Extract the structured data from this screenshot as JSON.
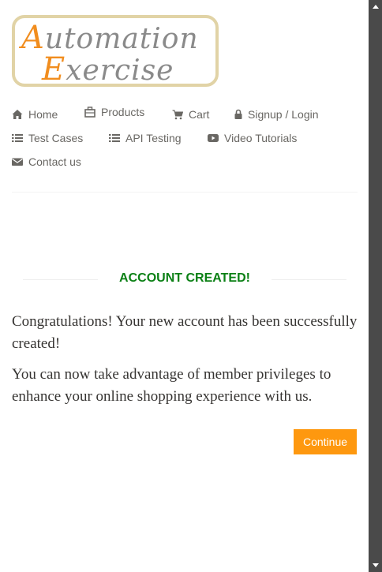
{
  "logo": {
    "line1_cap": "A",
    "line1_rest": "utomation",
    "line2_cap": "E",
    "line2_rest": "xercise"
  },
  "nav": {
    "items": [
      {
        "label": "Home",
        "icon": "home-icon"
      },
      {
        "label": "Products",
        "icon": "products-icon"
      },
      {
        "label": "Cart",
        "icon": "cart-icon"
      },
      {
        "label": "Signup / Login",
        "icon": "lock-icon"
      },
      {
        "label": "Test Cases",
        "icon": "list-icon"
      },
      {
        "label": "API Testing",
        "icon": "list-icon"
      },
      {
        "label": "Video Tutorials",
        "icon": "youtube-icon"
      },
      {
        "label": "Contact us",
        "icon": "envelope-icon"
      }
    ]
  },
  "main": {
    "title": "ACCOUNT CREATED!",
    "message1": "Congratulations! Your new account has been successfully created!",
    "message2": "You can now take advantage of member privileges to enhance your online shopping experience with us.",
    "continue_label": "Continue"
  },
  "colors": {
    "title": "#0b8015",
    "button": "#fe980f",
    "logo_accent": "#f18d1e",
    "nav_text": "#696763",
    "scrollbar": "#4a4a4a"
  }
}
